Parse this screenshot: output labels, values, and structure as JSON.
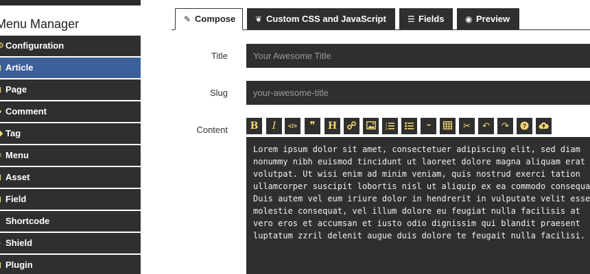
{
  "sidebar": {
    "title": "Menu Manager",
    "items": [
      {
        "label": "Configuration",
        "icon": "cogs-icon",
        "active": false
      },
      {
        "label": "Article",
        "icon": "file-icon",
        "active": true
      },
      {
        "label": "Page",
        "icon": "file-icon",
        "active": false
      },
      {
        "label": "Comment",
        "icon": "comment-icon",
        "active": false
      },
      {
        "label": "Tag",
        "icon": "tag-icon",
        "active": false
      },
      {
        "label": "Menu",
        "icon": "menu-icon",
        "active": false
      },
      {
        "label": "Asset",
        "icon": "folder-icon",
        "active": false
      },
      {
        "label": "Field",
        "icon": "field-icon",
        "active": false
      },
      {
        "label": "Shortcode",
        "icon": "code-icon",
        "active": false
      },
      {
        "label": "Shield",
        "icon": "shield-icon",
        "active": false
      },
      {
        "label": "Plugin",
        "icon": "plug-icon",
        "active": false
      }
    ]
  },
  "tabs": [
    {
      "label": "Compose",
      "icon": "pencil-icon",
      "active": true
    },
    {
      "label": "Custom CSS and JavaScript",
      "icon": "leaf-icon",
      "active": false
    },
    {
      "label": "Fields",
      "icon": "list-icon",
      "active": false
    },
    {
      "label": "Preview",
      "icon": "eye-icon",
      "active": false
    }
  ],
  "form": {
    "title_label": "Title",
    "title_placeholder": "Your Awesome Title",
    "slug_label": "Slug",
    "slug_placeholder": "your-awesome-title",
    "content_label": "Content"
  },
  "toolbar": [
    {
      "name": "bold-button",
      "glyph": "B"
    },
    {
      "name": "italic-button",
      "glyph": "I"
    },
    {
      "name": "code-button",
      "glyph": "</>"
    },
    {
      "name": "quote-button",
      "glyph": "❞"
    },
    {
      "name": "heading-button",
      "glyph": "H"
    },
    {
      "name": "link-button",
      "glyph": "link"
    },
    {
      "name": "image-button",
      "glyph": "image"
    },
    {
      "name": "ordered-list-button",
      "glyph": "ol"
    },
    {
      "name": "unordered-list-button",
      "glyph": "ul"
    },
    {
      "name": "more-button",
      "glyph": "•••"
    },
    {
      "name": "table-button",
      "glyph": "table"
    },
    {
      "name": "cut-button",
      "glyph": "✂"
    },
    {
      "name": "undo-button",
      "glyph": "↶"
    },
    {
      "name": "redo-button",
      "glyph": "↷"
    },
    {
      "name": "help-button",
      "glyph": "?"
    },
    {
      "name": "upload-button",
      "glyph": "cloud"
    }
  ],
  "content": "Lorem ipsum dolor sit amet, consectetuer adipiscing elit, sed diam\nnonummy nibh euismod tincidunt ut laoreet dolore magna aliquam erat\nvolutpat. Ut wisi enim ad minim veniam, quis nostrud exerci tation\nullamcorper suscipit lobortis nisl ut aliquip ex ea commodo consequat.\nDuis autem vel eum iriure dolor in hendrerit in vulputate velit esse\nmolestie consequat, vel illum dolore eu feugiat nulla facilisis at\nvero eros et accumsan et iusto odio dignissim qui blandit praesent\nluptatum zzril delenit augue duis dolore te feugait nulla facilisi.",
  "colors": {
    "dark": "#2f2f2f",
    "active": "#3a5f99",
    "accent": "#f5d76e"
  }
}
